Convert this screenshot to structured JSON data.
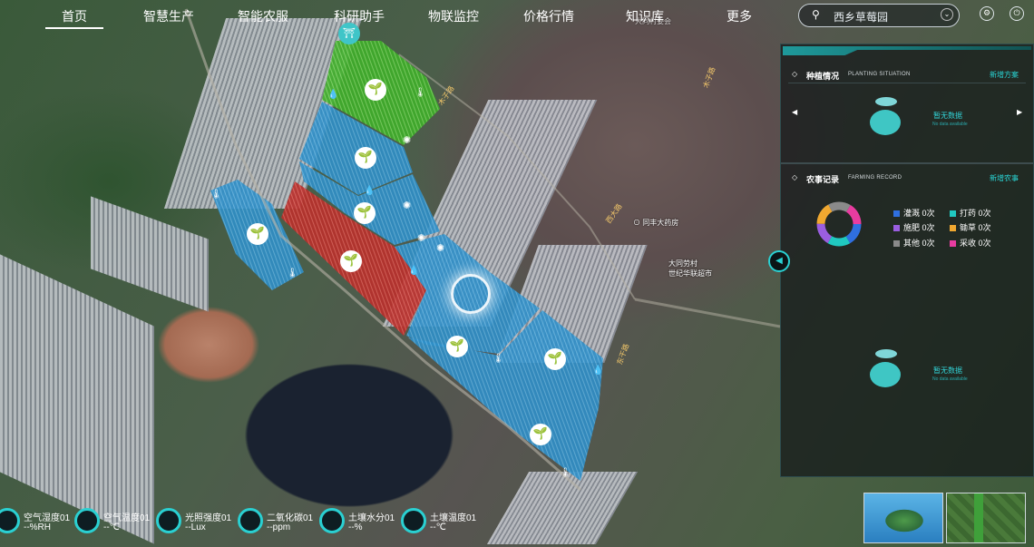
{
  "nav": {
    "items": [
      "首页",
      "智慧生产",
      "智能农服",
      "科研助手",
      "物联监控",
      "价格行情",
      "知识库",
      "更多"
    ],
    "active_index": 0,
    "location": "西乡草莓园"
  },
  "map": {
    "labels": {
      "poi_pharmacy": "同丰大药房",
      "poi_village": "大同劳村",
      "poi_market": "世纪华联超市",
      "road_1": "木子路",
      "road_2": "西大路",
      "road_3": "东干路",
      "road_4": "木子路",
      "village_committee": "大同村委会"
    },
    "colors": {
      "blue": "#2f8fc8",
      "green": "#3fae2a",
      "red": "#b8302c"
    }
  },
  "panel": {
    "planting": {
      "title": "种植情况",
      "title_en": "PLANTING SITUATION",
      "action": "新增方案",
      "nodata": "暂无数据",
      "nodata_en": "No data available"
    },
    "farming": {
      "title": "农事记录",
      "title_en": "FARMING RECORD",
      "action": "新增农事",
      "nodata": "暂无数据",
      "nodata_en": "No data available",
      "legend": [
        {
          "label": "灌溉 0次",
          "color": "#2f6fe0"
        },
        {
          "label": "打药 0次",
          "color": "#20c9c0"
        },
        {
          "label": "施肥 0次",
          "color": "#9a5ee0"
        },
        {
          "label": "锄草 0次",
          "color": "#f0a830"
        },
        {
          "label": "其他 0次",
          "color": "#8a8a8a"
        },
        {
          "label": "采收 0次",
          "color": "#e83ca0"
        }
      ]
    }
  },
  "sensors": [
    {
      "name": "空气湿度01",
      "value": "--%RH",
      "icon": "humidity-icon"
    },
    {
      "name": "空气温度01",
      "value": "--℃",
      "icon": "thermometer-icon"
    },
    {
      "name": "光照强度01",
      "value": "--Lux",
      "icon": "sun-icon"
    },
    {
      "name": "二氧化碳01",
      "value": "--ppm",
      "icon": "co2-icon"
    },
    {
      "name": "土壤水分01",
      "value": "--%",
      "icon": "water-drop-icon"
    },
    {
      "name": "土壤温度01",
      "value": "--℃",
      "icon": "soil-temp-icon"
    }
  ]
}
